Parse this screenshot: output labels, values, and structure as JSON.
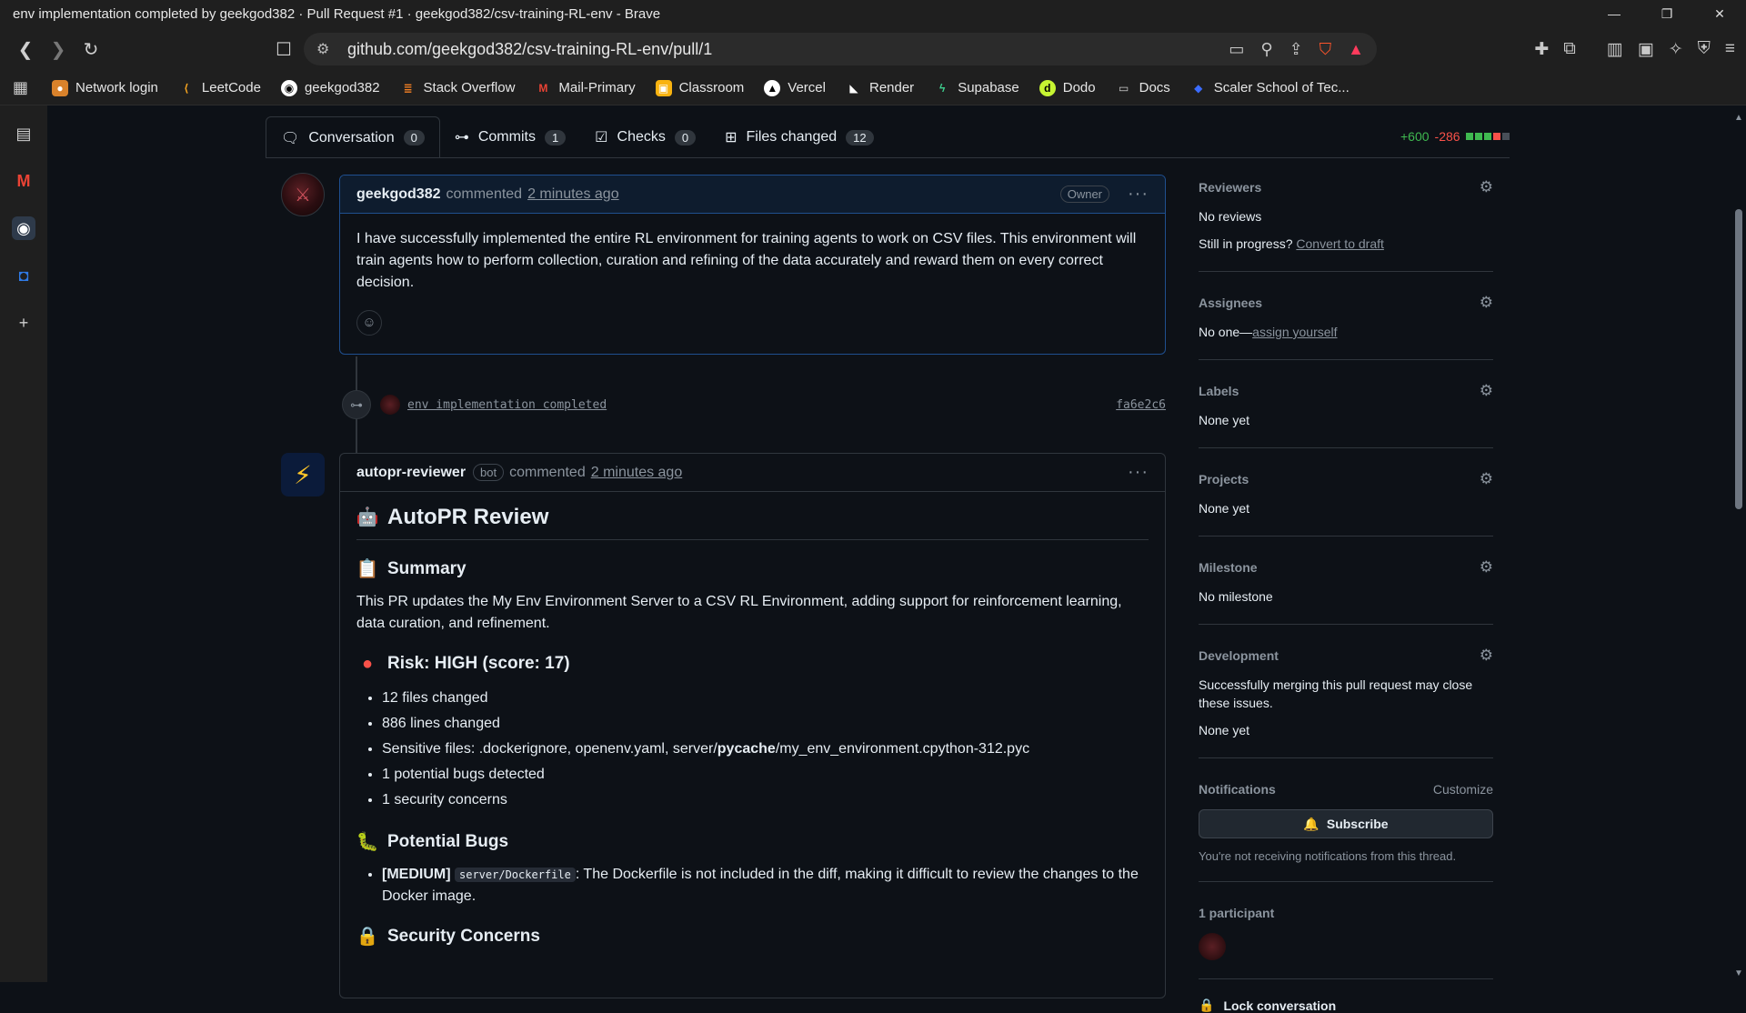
{
  "browser": {
    "window_title": "env implementation completed by geekgod382 · Pull Request #1 · geekgod382/csv-training-RL-env - Brave",
    "url": "github.com/geekgod382/csv-training-RL-env/pull/1",
    "bookmarks": [
      {
        "label": "Network login",
        "icon": "globe-icon",
        "color": "#d9822b"
      },
      {
        "label": "LeetCode",
        "icon": "leetcode-icon",
        "color": "#f0a020"
      },
      {
        "label": "geekgod382",
        "icon": "github-icon",
        "color": "#ffffff"
      },
      {
        "label": "Stack Overflow",
        "icon": "stackoverflow-icon",
        "color": "#f48024"
      },
      {
        "label": "Mail-Primary",
        "icon": "gmail-icon",
        "color": "#ea4335"
      },
      {
        "label": "Classroom",
        "icon": "classroom-icon",
        "color": "#f9b310"
      },
      {
        "label": "Vercel",
        "icon": "vercel-icon",
        "color": "#ffffff"
      },
      {
        "label": "Render",
        "icon": "render-icon",
        "color": "#ffffff"
      },
      {
        "label": "Supabase",
        "icon": "supabase-icon",
        "color": "#3ecf8e"
      },
      {
        "label": "Dodo",
        "icon": "dodo-icon",
        "color": "#c6f432"
      },
      {
        "label": "Docs",
        "icon": "folder-icon",
        "color": "#cccccc"
      },
      {
        "label": "Scaler School of Tec...",
        "icon": "scaler-icon",
        "color": "#3b6cff"
      }
    ]
  },
  "tabs": [
    {
      "label": "Conversation",
      "count": "0",
      "icon": "conversation-icon"
    },
    {
      "label": "Commits",
      "count": "1",
      "icon": "commit-icon"
    },
    {
      "label": "Checks",
      "count": "0",
      "icon": "checks-icon"
    },
    {
      "label": "Files changed",
      "count": "12",
      "icon": "file-diff-icon"
    }
  ],
  "diffstat": {
    "additions": "+600",
    "deletions": "-286"
  },
  "comment1": {
    "author": "geekgod382",
    "action": "commented",
    "time": "2 minutes ago",
    "badge": "Owner",
    "body": "I have successfully implemented the entire RL environment for training agents to work on CSV files. This environment will train agents how to perform collection, curation and refining of the data accurately and reward them on every correct decision."
  },
  "commit": {
    "message": "env implementation completed",
    "sha": "fa6e2c6"
  },
  "comment2": {
    "author": "autopr-reviewer",
    "badge": "bot",
    "action": "commented",
    "time": "2 minutes ago",
    "heading": "AutoPR Review",
    "summary_title": "Summary",
    "summary_text": "This PR updates the My Env Environment Server to a CSV RL Environment, adding support for reinforcement learning, data curation, and refinement.",
    "risk_title": "Risk: HIGH (score: 17)",
    "risk_items": [
      "12 files changed",
      "886 lines changed"
    ],
    "sensitive_prefix": "Sensitive files: .dockerignore, openenv.yaml, server/",
    "sensitive_bold": "pycache",
    "sensitive_suffix": "/my_env_environment.cpython-312.pyc",
    "risk_items2": [
      "1 potential bugs detected",
      "1 security concerns"
    ],
    "bugs_title": "Potential Bugs",
    "bug_severity": "[MEDIUM]",
    "bug_file": "server/Dockerfile",
    "bug_text": ": The Dockerfile is not included in the diff, making it difficult to review the changes to the Docker image.",
    "security_title": "Security Concerns"
  },
  "sidebar": {
    "reviewers": {
      "title": "Reviewers",
      "value": "No reviews",
      "progress_prefix": "Still in progress?",
      "progress_link": "Convert to draft"
    },
    "assignees": {
      "title": "Assignees",
      "prefix": "No one—",
      "link": "assign yourself"
    },
    "labels": {
      "title": "Labels",
      "value": "None yet"
    },
    "projects": {
      "title": "Projects",
      "value": "None yet"
    },
    "milestone": {
      "title": "Milestone",
      "value": "No milestone"
    },
    "development": {
      "title": "Development",
      "text": "Successfully merging this pull request may close these issues.",
      "value": "None yet"
    },
    "notifications": {
      "title": "Notifications",
      "customize": "Customize",
      "button": "Subscribe",
      "note": "You're not receiving notifications from this thread."
    },
    "participants": {
      "title": "1 participant"
    },
    "lock": "Lock conversation"
  }
}
